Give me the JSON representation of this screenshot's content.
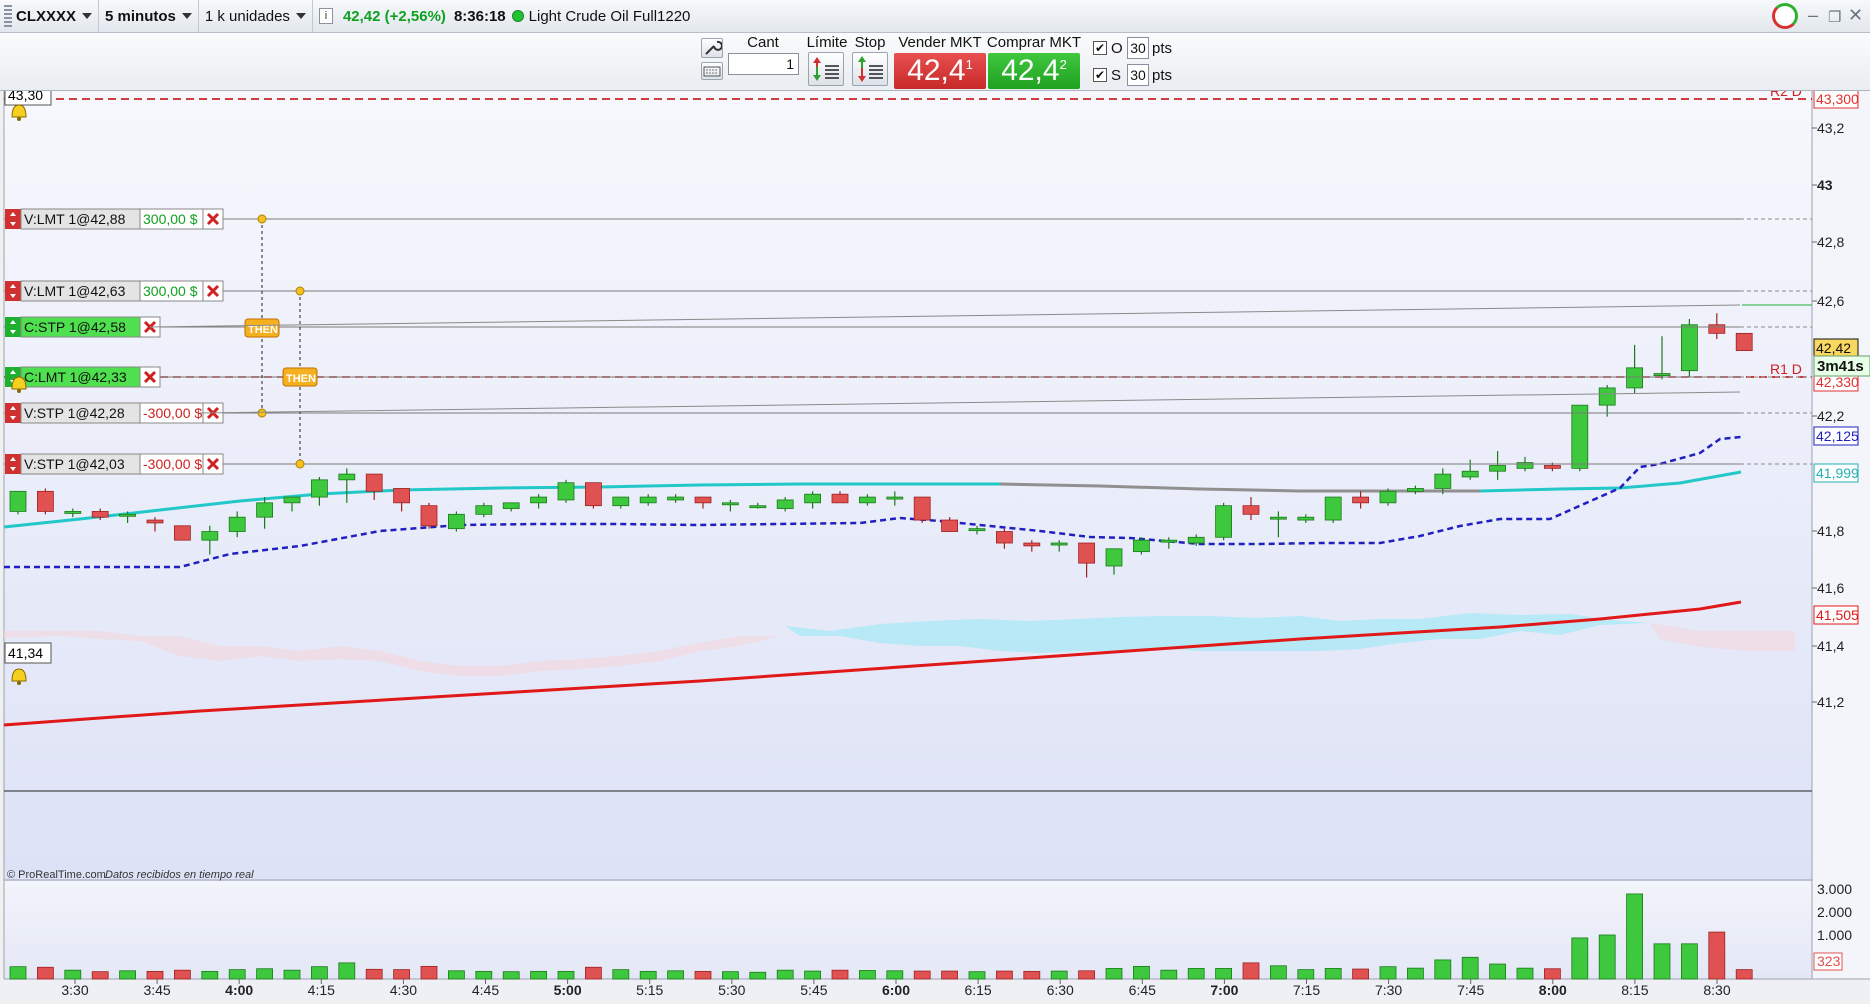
{
  "header": {
    "symbol": "CLXXXX",
    "timeframe": "5 minutos",
    "units": "1 k unidades",
    "quote": "42,42 (+2,56%)",
    "time": "8:36:18",
    "instrument": "Light Crude Oil Full1220"
  },
  "tradebar": {
    "qty_label": "Cant",
    "qty_value": "1",
    "limit_label": "Límite",
    "stop_label": "Stop",
    "sell_label": "Vender MKT",
    "sell_price": "42,4",
    "sell_sup": "1",
    "buy_label": "Comprar MKT",
    "buy_price": "42,4",
    "buy_sup": "2",
    "o_label": "O",
    "o_value": "30",
    "s_label": "S",
    "s_value": "30",
    "pts_label": "pts"
  },
  "chart": {
    "top_label": "43,30",
    "bottom_label": "41,34",
    "copyright": "© ProRealTime.com",
    "realtime_note": "Datos recibidos en tiempo real",
    "countdown": "3m41s",
    "r2_label": "R2 D",
    "r1_label": "R1 D",
    "colors": {
      "up": "#3ec83e",
      "down": "#e05252",
      "ema_cyan": "#22c8c8",
      "dotted_blue": "#2020c0",
      "ma_red": "#e01818"
    }
  },
  "orders": [
    {
      "label": "V:LMT 1@42,88",
      "pnl": "300,00 $",
      "side": "sell",
      "price": 42.88
    },
    {
      "label": "V:LMT 1@42,63",
      "pnl": "300,00 $",
      "side": "sell",
      "price": 42.63
    },
    {
      "label": "C:STP 1@42,58",
      "pnl": "",
      "side": "buy",
      "price": 42.58
    },
    {
      "label": "C:LMT 1@42,33",
      "pnl": "",
      "side": "buy",
      "price": 42.33
    },
    {
      "label": "V:STP 1@42,28",
      "pnl": "-300,00 $",
      "side": "sell",
      "price": 42.28
    },
    {
      "label": "V:STP 1@42,03",
      "pnl": "-300,00 $",
      "side": "sell",
      "price": 42.03
    }
  ],
  "then_label": "THEN",
  "price_axis": {
    "ticks": [
      "43,2",
      "43",
      "42,8",
      "42,6",
      "42,2",
      "41,8",
      "41,6",
      "41,4",
      "41,2"
    ],
    "badges": [
      {
        "text": "43,300",
        "price": 43.3,
        "color": "#e03030"
      },
      {
        "text": "42,42",
        "price": 42.42,
        "color": "#111"
      },
      {
        "text": "42,330",
        "price": 42.33,
        "color": "#e03030"
      },
      {
        "text": "42,125",
        "price": 42.125,
        "color": "#2020c0"
      },
      {
        "text": "41,999",
        "price": 41.999,
        "color": "#22b0b0"
      },
      {
        "text": "41,505",
        "price": 41.505,
        "color": "#e01818"
      }
    ]
  },
  "time_axis": [
    "3:30",
    "3:45",
    "4:00",
    "4:15",
    "4:30",
    "4:45",
    "5:00",
    "5:15",
    "5:30",
    "5:45",
    "6:00",
    "6:15",
    "6:30",
    "6:45",
    "7:00",
    "7:15",
    "7:30",
    "7:45",
    "8:00",
    "8:15",
    "8:30"
  ],
  "volume_axis": [
    "3.000",
    "2.000",
    "1.000",
    "323"
  ],
  "chart_data": {
    "type": "candlestick",
    "candles": [
      [
        41.86,
        41.93,
        41.85,
        41.93
      ],
      [
        41.93,
        41.94,
        41.85,
        41.86
      ],
      [
        41.86,
        41.87,
        41.84,
        41.86
      ],
      [
        41.86,
        41.87,
        41.83,
        41.84
      ],
      [
        41.85,
        41.86,
        41.82,
        41.85
      ],
      [
        41.83,
        41.84,
        41.79,
        41.82
      ],
      [
        41.81,
        41.81,
        41.76,
        41.76
      ],
      [
        41.76,
        41.81,
        41.71,
        41.79
      ],
      [
        41.79,
        41.86,
        41.77,
        41.84
      ],
      [
        41.84,
        41.91,
        41.8,
        41.89
      ],
      [
        41.89,
        41.91,
        41.86,
        41.91
      ],
      [
        41.91,
        41.98,
        41.88,
        41.97
      ],
      [
        41.97,
        42.01,
        41.89,
        41.99
      ],
      [
        41.99,
        41.99,
        41.9,
        41.93
      ],
      [
        41.94,
        41.94,
        41.86,
        41.89
      ],
      [
        41.88,
        41.89,
        41.8,
        41.81
      ],
      [
        41.8,
        41.86,
        41.79,
        41.85
      ],
      [
        41.85,
        41.89,
        41.84,
        41.88
      ],
      [
        41.87,
        41.89,
        41.86,
        41.89
      ],
      [
        41.89,
        41.92,
        41.87,
        41.91
      ],
      [
        41.9,
        41.97,
        41.89,
        41.96
      ],
      [
        41.96,
        41.96,
        41.87,
        41.88
      ],
      [
        41.88,
        41.91,
        41.87,
        41.91
      ],
      [
        41.89,
        41.92,
        41.88,
        41.91
      ],
      [
        41.9,
        41.92,
        41.89,
        41.91
      ],
      [
        41.91,
        41.91,
        41.87,
        41.89
      ],
      [
        41.89,
        41.9,
        41.86,
        41.89
      ],
      [
        41.88,
        41.89,
        41.87,
        41.88
      ],
      [
        41.87,
        41.91,
        41.86,
        41.9
      ],
      [
        41.89,
        41.93,
        41.87,
        41.92
      ],
      [
        41.92,
        41.93,
        41.89,
        41.89
      ],
      [
        41.89,
        41.92,
        41.88,
        41.91
      ],
      [
        41.91,
        41.93,
        41.88,
        41.91
      ],
      [
        41.91,
        41.91,
        41.82,
        41.83
      ],
      [
        41.83,
        41.84,
        41.79,
        41.79
      ],
      [
        41.8,
        41.81,
        41.78,
        41.8
      ],
      [
        41.79,
        41.8,
        41.73,
        41.75
      ],
      [
        41.75,
        41.76,
        41.72,
        41.74
      ],
      [
        41.75,
        41.76,
        41.72,
        41.75
      ],
      [
        41.75,
        41.75,
        41.63,
        41.68
      ],
      [
        41.67,
        41.73,
        41.64,
        41.73
      ],
      [
        41.72,
        41.77,
        41.71,
        41.76
      ],
      [
        41.76,
        41.77,
        41.73,
        41.76
      ],
      [
        41.75,
        41.78,
        41.74,
        41.77
      ],
      [
        41.77,
        41.89,
        41.76,
        41.88
      ],
      [
        41.88,
        41.91,
        41.83,
        41.85
      ],
      [
        41.84,
        41.86,
        41.77,
        41.84
      ],
      [
        41.83,
        41.85,
        41.82,
        41.84
      ],
      [
        41.83,
        41.91,
        41.82,
        41.91
      ],
      [
        41.91,
        41.93,
        41.87,
        41.89
      ],
      [
        41.89,
        41.94,
        41.88,
        41.93
      ],
      [
        41.93,
        41.95,
        41.92,
        41.94
      ],
      [
        41.94,
        42.01,
        41.92,
        41.99
      ],
      [
        41.98,
        42.04,
        41.97,
        42.0
      ],
      [
        42.0,
        42.07,
        41.97,
        42.02
      ],
      [
        42.01,
        42.05,
        42.0,
        42.03
      ],
      [
        42.02,
        42.03,
        42.0,
        42.01
      ],
      [
        42.01,
        42.23,
        42.0,
        42.23
      ],
      [
        42.23,
        42.3,
        42.19,
        42.29
      ],
      [
        42.29,
        42.44,
        42.27,
        42.36
      ],
      [
        42.34,
        42.47,
        42.32,
        42.34
      ],
      [
        42.35,
        42.53,
        42.33,
        42.51
      ],
      [
        42.51,
        42.55,
        42.46,
        42.48
      ],
      [
        42.48,
        42.48,
        42.43,
        42.42
      ]
    ],
    "volume": [
      420,
      400,
      300,
      250,
      280,
      260,
      300,
      260,
      320,
      350,
      300,
      420,
      550,
      330,
      320,
      430,
      280,
      260,
      250,
      260,
      260,
      400,
      320,
      260,
      280,
      260,
      250,
      230,
      300,
      270,
      300,
      290,
      280,
      270,
      270,
      250,
      270,
      260,
      270,
      280,
      360,
      430,
      300,
      360,
      360,
      550,
      450,
      320,
      360,
      340,
      420,
      370,
      650,
      740,
      510,
      370,
      350,
      1400,
      1500,
      2900,
      1200,
      1200,
      1600,
      320
    ]
  }
}
